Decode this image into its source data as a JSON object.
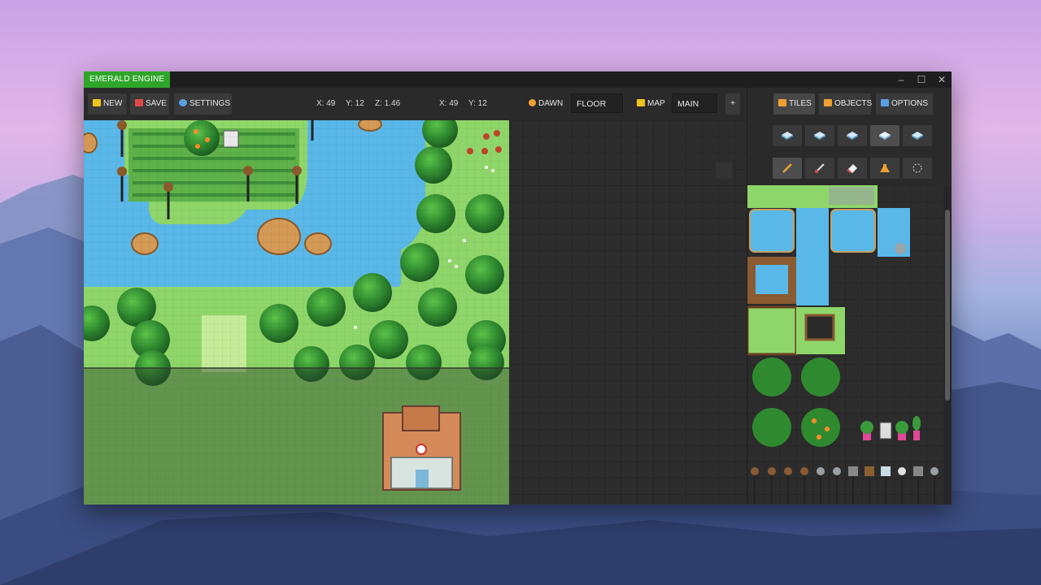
{
  "window": {
    "app_title": "EMERALD ENGINE",
    "controls": {
      "minimize": "–",
      "maximize": "☐",
      "close": "✕"
    }
  },
  "toolbar": {
    "new_label": "NEW",
    "save_label": "SAVE",
    "settings_label": "SETTINGS",
    "cursor": {
      "x": "X: 49",
      "y": "Y: 12",
      "z": "Z: 1.46"
    },
    "tile": {
      "x": "X: 49",
      "y": "Y: 12"
    },
    "time_label": "DAWN",
    "layer_value": "FLOOR",
    "map_label": "MAP",
    "map_value": "MAIN",
    "add_label": "+"
  },
  "panel": {
    "tabs": [
      {
        "label": "TILES",
        "icon": "hammer-icon",
        "active": true
      },
      {
        "label": "OBJECTS",
        "icon": "box-icon",
        "active": false
      },
      {
        "label": "OPTIONS",
        "icon": "wrench-icon",
        "active": false
      }
    ],
    "layers": [
      "layer-1-icon",
      "layer-2-icon",
      "layer-3-icon",
      "layer-4-icon",
      "layer-5-icon"
    ],
    "active_layer": 3,
    "tools": [
      "pencil-icon",
      "brush-icon",
      "eraser-icon",
      "fill-icon",
      "select-icon"
    ],
    "active_tool": 0
  },
  "colors": {
    "accent": "#2fa62a",
    "water": "#5ab8e8",
    "grass": "#8fd66a",
    "tree": "#2f8a2f"
  }
}
